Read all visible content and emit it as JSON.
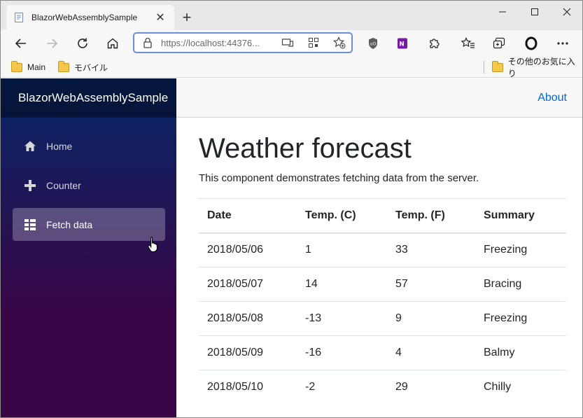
{
  "browser": {
    "tab_title": "BlazorWebAssemblySample",
    "address_url": "https://localhost:44376...",
    "bookmarks": [
      {
        "label": "Main"
      },
      {
        "label": "モバイル"
      }
    ],
    "other_bookmarks": "その他のお気に入り"
  },
  "app": {
    "brand": "BlazorWebAssemblySample",
    "about_link": "About",
    "nav": [
      {
        "label": "Home",
        "icon": "home-icon"
      },
      {
        "label": "Counter",
        "icon": "plus-icon"
      },
      {
        "label": "Fetch data",
        "icon": "list-icon",
        "active": true
      }
    ],
    "page_title": "Weather forecast",
    "lead": "This component demonstrates fetching data from the server.",
    "table": {
      "headers": [
        "Date",
        "Temp. (C)",
        "Temp. (F)",
        "Summary"
      ],
      "rows": [
        [
          "2018/05/06",
          "1",
          "33",
          "Freezing"
        ],
        [
          "2018/05/07",
          "14",
          "57",
          "Bracing"
        ],
        [
          "2018/05/08",
          "-13",
          "9",
          "Freezing"
        ],
        [
          "2018/05/09",
          "-16",
          "4",
          "Balmy"
        ],
        [
          "2018/05/10",
          "-2",
          "29",
          "Chilly"
        ]
      ]
    }
  },
  "colors": {
    "sidebar_top": "#052767",
    "sidebar_bottom": "#3a0647",
    "link": "#0366d6"
  }
}
